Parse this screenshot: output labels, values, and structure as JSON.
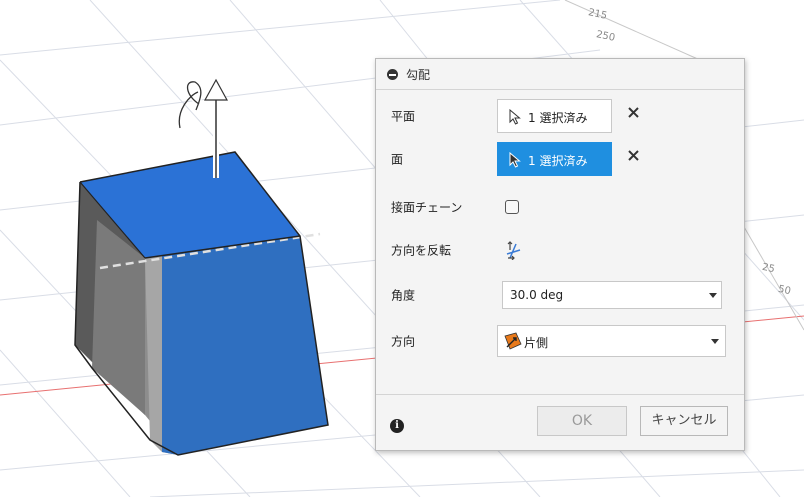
{
  "viewport": {
    "ruler_labels": [
      "215",
      "250",
      "25",
      "50"
    ]
  },
  "panel": {
    "title": "勾配",
    "rows": {
      "plane": {
        "label": "平面",
        "selection": "1 選択済み"
      },
      "face": {
        "label": "面",
        "selection": "1 選択済み"
      },
      "tangent_chain": {
        "label": "接面チェーン",
        "checked": false
      },
      "flip": {
        "label": "方向を反転"
      },
      "angle": {
        "label": "角度",
        "value": "30.0 deg"
      },
      "direction": {
        "label": "方向",
        "value": "片側"
      }
    },
    "ok_label": "OK",
    "cancel_label": "キャンセル",
    "info_glyph": "i",
    "clear_glyph": "✕",
    "colors": {
      "accent": "#1f8fe0",
      "face_blue": "#2f6fc0",
      "top_face": "#2b72d6"
    }
  }
}
